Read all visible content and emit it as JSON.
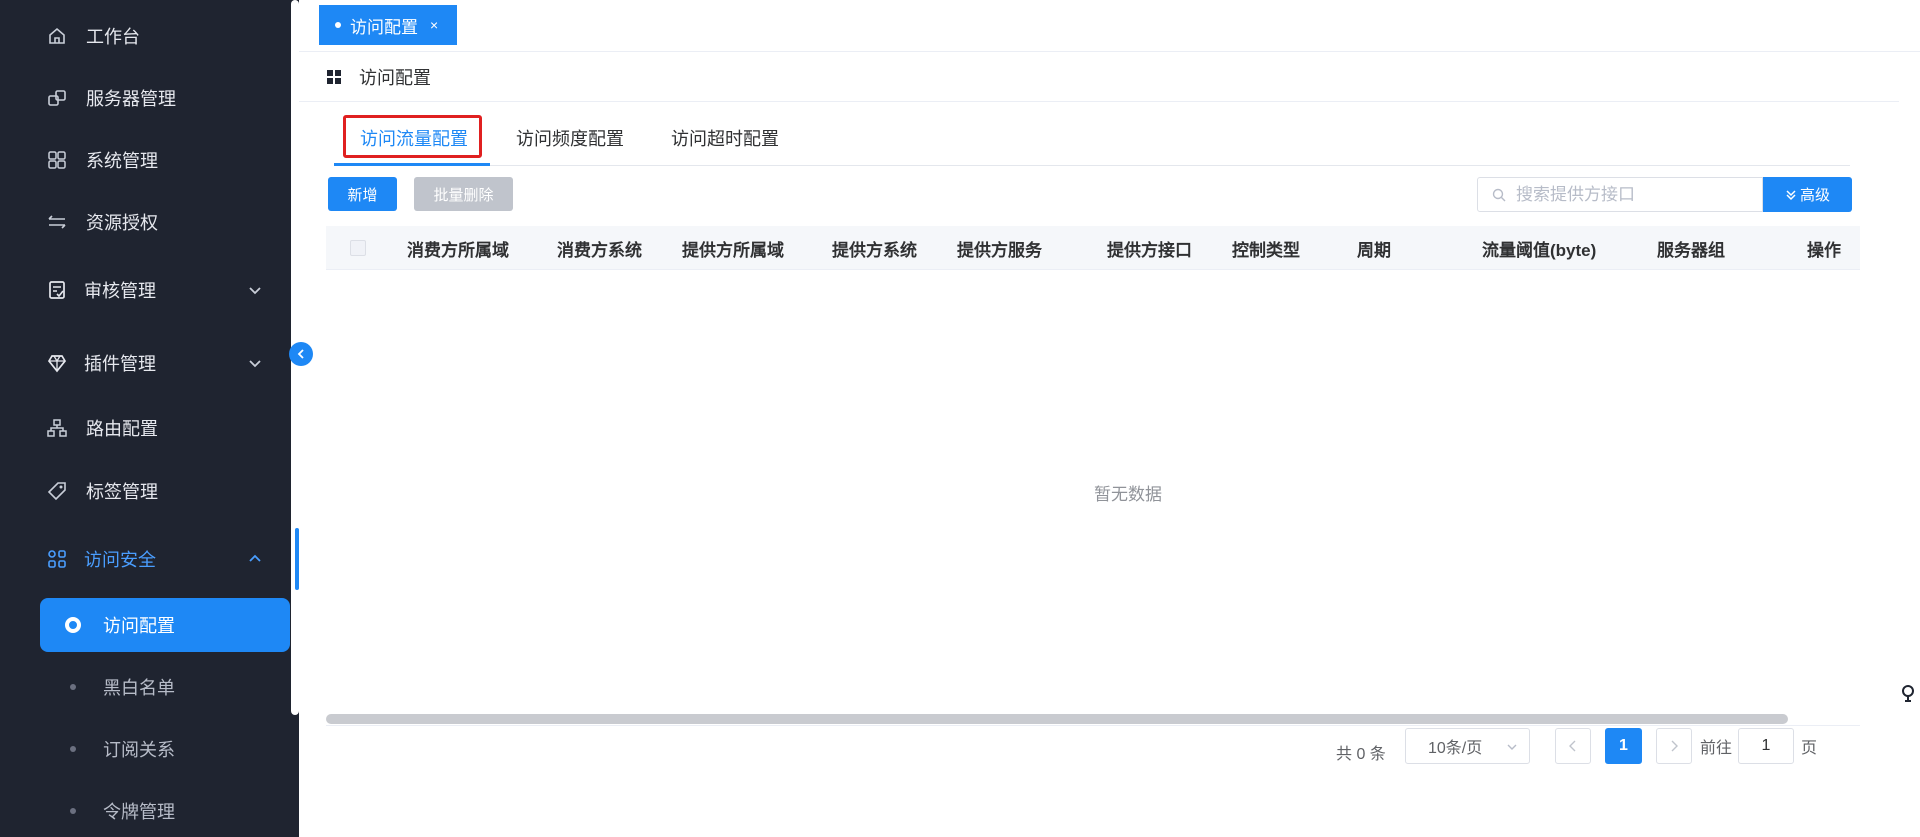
{
  "sidebar": {
    "items": [
      {
        "label": "工作台",
        "icon": "home-icon"
      },
      {
        "label": "服务器管理",
        "icon": "server-icon"
      },
      {
        "label": "系统管理",
        "icon": "grid-icon"
      },
      {
        "label": "资源授权",
        "icon": "swap-icon"
      },
      {
        "label": "审核管理",
        "icon": "audit-icon"
      },
      {
        "label": "插件管理",
        "icon": "diamond-icon"
      },
      {
        "label": "路由配置",
        "icon": "route-icon"
      },
      {
        "label": "标签管理",
        "icon": "tag-icon"
      },
      {
        "label": "访问安全",
        "icon": "security-icon"
      }
    ],
    "subitems": [
      {
        "label": "访问配置"
      },
      {
        "label": "黑白名单"
      },
      {
        "label": "订阅关系"
      },
      {
        "label": "令牌管理"
      }
    ]
  },
  "top_tabs": [
    {
      "label": "访问配置",
      "close": "×"
    }
  ],
  "breadcrumb": {
    "title": "访问配置"
  },
  "sub_tabs": [
    {
      "label": "访问流量配置"
    },
    {
      "label": "访问频度配置"
    },
    {
      "label": "访问超时配置"
    }
  ],
  "toolbar": {
    "add_label": "新增",
    "batch_delete_label": "批量删除",
    "search_placeholder": "搜索提供方接口",
    "advanced_label": "高级"
  },
  "table": {
    "columns": [
      "消费方所属域",
      "消费方系统",
      "提供方所属域",
      "提供方系统",
      "提供方服务",
      "提供方接口",
      "控制类型",
      "周期",
      "流量阈值(byte)",
      "服务器组",
      "操作"
    ],
    "empty_text": "暂无数据"
  },
  "pagination": {
    "total_text": "共 0 条",
    "page_size": "10条/页",
    "current_page": "1",
    "goto_label": "前往",
    "goto_value": "1",
    "page_suffix": "页"
  },
  "colors": {
    "sidebar_bg": "#1f2430",
    "accent": "#1e88f5",
    "highlight": "#e02020"
  }
}
